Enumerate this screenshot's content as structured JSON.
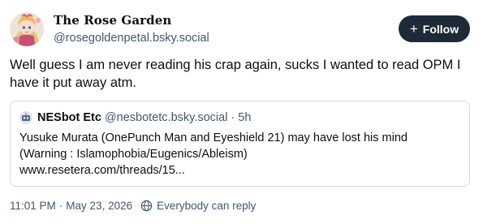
{
  "author": {
    "display_name": "The Rose Garden",
    "handle": "@rosegoldenpetal.bsky.social",
    "avatar_icon": "anime-character-avatar"
  },
  "follow_button": {
    "label": "Follow",
    "icon": "plus-icon"
  },
  "post": {
    "text": "Well guess I am never reading his crap again, sucks I wanted to read OPM I have it put away atm."
  },
  "quote": {
    "author_name": "NESbot Etc",
    "author_handle": "@nesbotetc.bsky.social",
    "separator": "·",
    "time": "5h",
    "lines": [
      "Yusuke Murata (OnePunch Man and Eyeshield 21) may have lost his mind",
      "(Warning : Islamophobia/Eugenics/Ableism)",
      "www.resetera.com/threads/15..."
    ]
  },
  "meta": {
    "time": "11:01 PM",
    "separator": "·",
    "date": "May 23, 2026",
    "reply_setting": "Everybody can reply",
    "reply_icon": "globe-icon"
  },
  "colors": {
    "follow_bg": "#1e2a37",
    "secondary_text": "#42576c",
    "border": "#d4dbe2"
  }
}
